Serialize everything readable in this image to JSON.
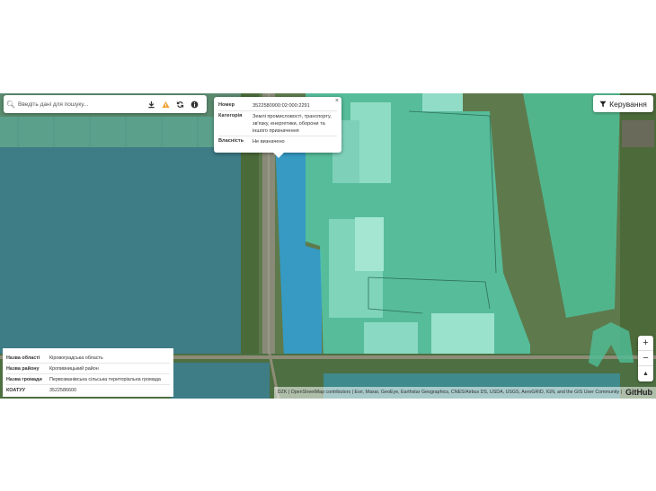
{
  "search": {
    "placeholder": "Введіть дані для пошуку...",
    "icons": [
      "search-icon",
      "download-icon",
      "warning-icon",
      "refresh-icon",
      "info-icon"
    ]
  },
  "popup": {
    "close": "×",
    "rows": [
      {
        "label": "Номер",
        "value": "3522580900:02:000:2291"
      },
      {
        "label": "Категорія",
        "value": "Землі промисловості, транспорту, зв'язку, енергетики, оборони та іншого призначення"
      },
      {
        "label": "Власність",
        "value": "Не визначено"
      }
    ]
  },
  "controls": {
    "label": "Керування",
    "icon": "filter-icon"
  },
  "zoom": {
    "in": "+",
    "out": "−",
    "north": "▲"
  },
  "info_panel": {
    "rows": [
      {
        "label": "Назва області",
        "value": "Кіровоградська область"
      },
      {
        "label": "Назва району",
        "value": "Кропивницький район"
      },
      {
        "label": "Назва громади",
        "value": "Первозванівська сільська територіальна громада"
      },
      {
        "label": "КОАТУУ",
        "value": "3522586600"
      }
    ]
  },
  "attribution": {
    "text": "DZK | OpenStreetMap contributors | Esri, Maxar, GeoEye, Earthstar Geographics, CNES/Airbus DS, USDA, USGS, AeroGRID, IGN, and the GIS User Community |",
    "logo": "GitHub"
  },
  "colors": {
    "parcel_fill": "#4fc9b0",
    "selected_parcel": "#2fa8e0",
    "field_dark": "#2e6f78"
  }
}
